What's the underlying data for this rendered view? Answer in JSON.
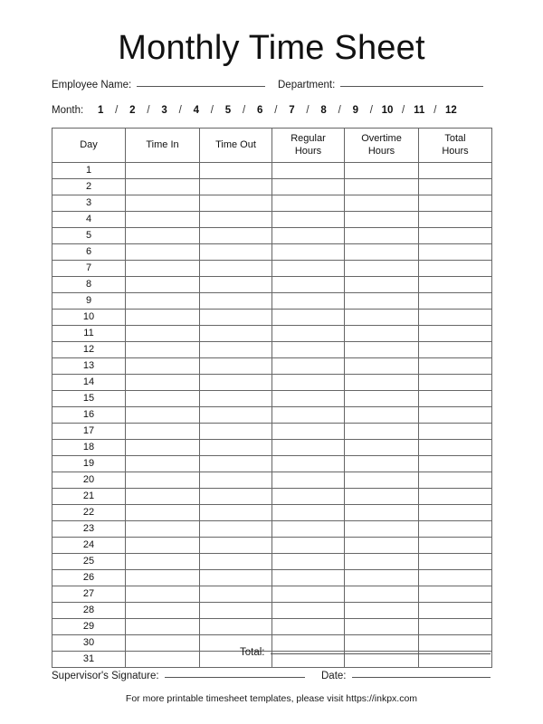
{
  "document": {
    "title": "Monthly Time Sheet"
  },
  "header_fields": {
    "employee_name_label": "Employee Name:",
    "employee_name_value": "",
    "department_label": "Department:",
    "department_value": "",
    "month_label": "Month:",
    "month_options": [
      "1",
      "2",
      "3",
      "4",
      "5",
      "6",
      "7",
      "8",
      "9",
      "10",
      "11",
      "12"
    ],
    "month_separator": "/"
  },
  "table": {
    "columns": [
      {
        "line1": "Day",
        "line2": ""
      },
      {
        "line1": "Time In",
        "line2": ""
      },
      {
        "line1": "Time Out",
        "line2": ""
      },
      {
        "line1": "Regular",
        "line2": "Hours"
      },
      {
        "line1": "Overtime",
        "line2": "Hours"
      },
      {
        "line1": "Total",
        "line2": "Hours"
      }
    ],
    "rows": [
      {
        "day": "1",
        "time_in": "",
        "time_out": "",
        "regular_hours": "",
        "overtime_hours": "",
        "total_hours": ""
      },
      {
        "day": "2",
        "time_in": "",
        "time_out": "",
        "regular_hours": "",
        "overtime_hours": "",
        "total_hours": ""
      },
      {
        "day": "3",
        "time_in": "",
        "time_out": "",
        "regular_hours": "",
        "overtime_hours": "",
        "total_hours": ""
      },
      {
        "day": "4",
        "time_in": "",
        "time_out": "",
        "regular_hours": "",
        "overtime_hours": "",
        "total_hours": ""
      },
      {
        "day": "5",
        "time_in": "",
        "time_out": "",
        "regular_hours": "",
        "overtime_hours": "",
        "total_hours": ""
      },
      {
        "day": "6",
        "time_in": "",
        "time_out": "",
        "regular_hours": "",
        "overtime_hours": "",
        "total_hours": ""
      },
      {
        "day": "7",
        "time_in": "",
        "time_out": "",
        "regular_hours": "",
        "overtime_hours": "",
        "total_hours": ""
      },
      {
        "day": "8",
        "time_in": "",
        "time_out": "",
        "regular_hours": "",
        "overtime_hours": "",
        "total_hours": ""
      },
      {
        "day": "9",
        "time_in": "",
        "time_out": "",
        "regular_hours": "",
        "overtime_hours": "",
        "total_hours": ""
      },
      {
        "day": "10",
        "time_in": "",
        "time_out": "",
        "regular_hours": "",
        "overtime_hours": "",
        "total_hours": ""
      },
      {
        "day": "11",
        "time_in": "",
        "time_out": "",
        "regular_hours": "",
        "overtime_hours": "",
        "total_hours": ""
      },
      {
        "day": "12",
        "time_in": "",
        "time_out": "",
        "regular_hours": "",
        "overtime_hours": "",
        "total_hours": ""
      },
      {
        "day": "13",
        "time_in": "",
        "time_out": "",
        "regular_hours": "",
        "overtime_hours": "",
        "total_hours": ""
      },
      {
        "day": "14",
        "time_in": "",
        "time_out": "",
        "regular_hours": "",
        "overtime_hours": "",
        "total_hours": ""
      },
      {
        "day": "15",
        "time_in": "",
        "time_out": "",
        "regular_hours": "",
        "overtime_hours": "",
        "total_hours": ""
      },
      {
        "day": "16",
        "time_in": "",
        "time_out": "",
        "regular_hours": "",
        "overtime_hours": "",
        "total_hours": ""
      },
      {
        "day": "17",
        "time_in": "",
        "time_out": "",
        "regular_hours": "",
        "overtime_hours": "",
        "total_hours": ""
      },
      {
        "day": "18",
        "time_in": "",
        "time_out": "",
        "regular_hours": "",
        "overtime_hours": "",
        "total_hours": ""
      },
      {
        "day": "19",
        "time_in": "",
        "time_out": "",
        "regular_hours": "",
        "overtime_hours": "",
        "total_hours": ""
      },
      {
        "day": "20",
        "time_in": "",
        "time_out": "",
        "regular_hours": "",
        "overtime_hours": "",
        "total_hours": ""
      },
      {
        "day": "21",
        "time_in": "",
        "time_out": "",
        "regular_hours": "",
        "overtime_hours": "",
        "total_hours": ""
      },
      {
        "day": "22",
        "time_in": "",
        "time_out": "",
        "regular_hours": "",
        "overtime_hours": "",
        "total_hours": ""
      },
      {
        "day": "23",
        "time_in": "",
        "time_out": "",
        "regular_hours": "",
        "overtime_hours": "",
        "total_hours": ""
      },
      {
        "day": "24",
        "time_in": "",
        "time_out": "",
        "regular_hours": "",
        "overtime_hours": "",
        "total_hours": ""
      },
      {
        "day": "25",
        "time_in": "",
        "time_out": "",
        "regular_hours": "",
        "overtime_hours": "",
        "total_hours": ""
      },
      {
        "day": "26",
        "time_in": "",
        "time_out": "",
        "regular_hours": "",
        "overtime_hours": "",
        "total_hours": ""
      },
      {
        "day": "27",
        "time_in": "",
        "time_out": "",
        "regular_hours": "",
        "overtime_hours": "",
        "total_hours": ""
      },
      {
        "day": "28",
        "time_in": "",
        "time_out": "",
        "regular_hours": "",
        "overtime_hours": "",
        "total_hours": ""
      },
      {
        "day": "29",
        "time_in": "",
        "time_out": "",
        "regular_hours": "",
        "overtime_hours": "",
        "total_hours": ""
      },
      {
        "day": "30",
        "time_in": "",
        "time_out": "",
        "regular_hours": "",
        "overtime_hours": "",
        "total_hours": ""
      },
      {
        "day": "31",
        "time_in": "",
        "time_out": "",
        "regular_hours": "",
        "overtime_hours": "",
        "total_hours": ""
      }
    ]
  },
  "footer_fields": {
    "total_label": "Total:",
    "total_value": "",
    "supervisor_signature_label": "Supervisor's Signature:",
    "supervisor_signature_value": "",
    "date_label": "Date:",
    "date_value": ""
  },
  "footer_note": {
    "text": "For more printable timesheet templates, please visit https://inkpx.com"
  },
  "colors": {
    "text": "#111111",
    "border": "#666666",
    "rule": "#555555",
    "background": "#ffffff"
  }
}
